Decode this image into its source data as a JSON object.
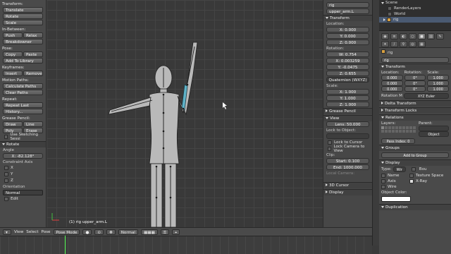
{
  "tools": {
    "transform_label": "Transform:",
    "translate": "Translate",
    "rotate": "Rotate",
    "scale": "Scale",
    "inbetween_label": "In-Between:",
    "push": "Push",
    "relax": "Relax",
    "breakdowner": "Breakdowner",
    "pose_label": "Pose:",
    "copy": "Copy",
    "paste": "Paste",
    "add_to_library": "Add To Library",
    "keyframes_label": "Keyframes:",
    "insert": "Insert",
    "remove": "Remove",
    "motion_paths_label": "Motion Paths:",
    "calculate_paths": "Calculate Paths",
    "clear_paths": "Clear Paths",
    "repeat_label": "Repeat:",
    "repeat_last": "Repeat Last",
    "history": "History...",
    "grease_pencil_label": "Grease Pencil:",
    "draw": "Draw",
    "line": "Line",
    "poly": "Poly",
    "erase": "Erase",
    "use_sketching": "Use Sketching Sessi",
    "rotate_panel": "Rotate",
    "angle_label": "Angle",
    "angle_value": "X: -82.128°",
    "constraint_axis": "Constraint Axis",
    "axis_x": "X",
    "axis_y": "Y",
    "axis_z": "Z",
    "orientation_label": "Orientation",
    "orientation_value": "Normal",
    "edit_label": "Edit"
  },
  "viewport": {
    "overlay_text": "(1) rig upper_arm.L"
  },
  "npanel": {
    "bone_field": "rig",
    "bone_name": "upper_arm.L",
    "transform_header": "Transform",
    "location_label": "Location:",
    "loc": [
      "X: 0.000",
      "Y: 0.000",
      "Z: 0.000"
    ],
    "rotation_label": "Rotation:",
    "rot": [
      "W: 0.754",
      "X: 0.003259",
      "Y: -0.0475",
      "Z: 0.655"
    ],
    "rotation_mode": "Quaternion (WXYZ)",
    "scale_label": "Scale:",
    "scale": [
      "X: 1.000",
      "Y: 1.000",
      "Z: 1.000"
    ],
    "grease_pencil": "Grease Pencil",
    "view_header": "View",
    "lens": "Lens: 50.000",
    "lock_to_object": "Lock to Object:",
    "lock_to_cursor": "Lock to Cursor",
    "lock_camera": "Lock Camera to View",
    "clip_label": "Clip:",
    "clip_start": "Start: 0.100",
    "clip_end": "End: 1000.000",
    "local_camera": "Local Camera:",
    "cursor_3d": "3D Cursor",
    "display": "Display"
  },
  "outliner": {
    "scene": "Scene",
    "render_layers": "RenderLayers",
    "world": "World",
    "rig": "rig"
  },
  "props": {
    "breadcrumb": "rig",
    "object_name": "rig",
    "transform_header": "Transform",
    "location_label": "Location:",
    "rotation_label": "Rotation:",
    "scale_label": "Scale:",
    "loc": [
      "0.000",
      "0.000",
      "0.000"
    ],
    "rot": [
      "0°",
      "0°",
      "0°"
    ],
    "scl": [
      "1.000",
      "1.000",
      "1.000"
    ],
    "rotation_mode_label": "Rotation M",
    "rotation_mode": "XYZ Euler",
    "delta_transform": "Delta Transform",
    "transform_locks": "Transform Locks",
    "relations": "Relations",
    "layers_label": "Layers:",
    "parent_label": "Parent:",
    "parent_type": "Object",
    "pass_index": "Pass Index: 0",
    "groups": "Groups",
    "add_to_group": "Add to Group",
    "display": "Display",
    "type_label": "Type:",
    "type_value": "Wir",
    "bounds": "Bou",
    "name": "Name",
    "texture_space": "Texture Space",
    "axis": "Axis",
    "xray": "X-Ray",
    "wire": "Wire",
    "object_color": "Object Color:",
    "duplication": "Duplication"
  },
  "header": {
    "view": "View",
    "select": "Select",
    "pose": "Pose",
    "mode": "Pose Mode",
    "pivot": "Normal"
  },
  "colors": {
    "accent": "#5680c2",
    "selected_bone": "#5fb3c8",
    "playhead": "#55ff55"
  }
}
